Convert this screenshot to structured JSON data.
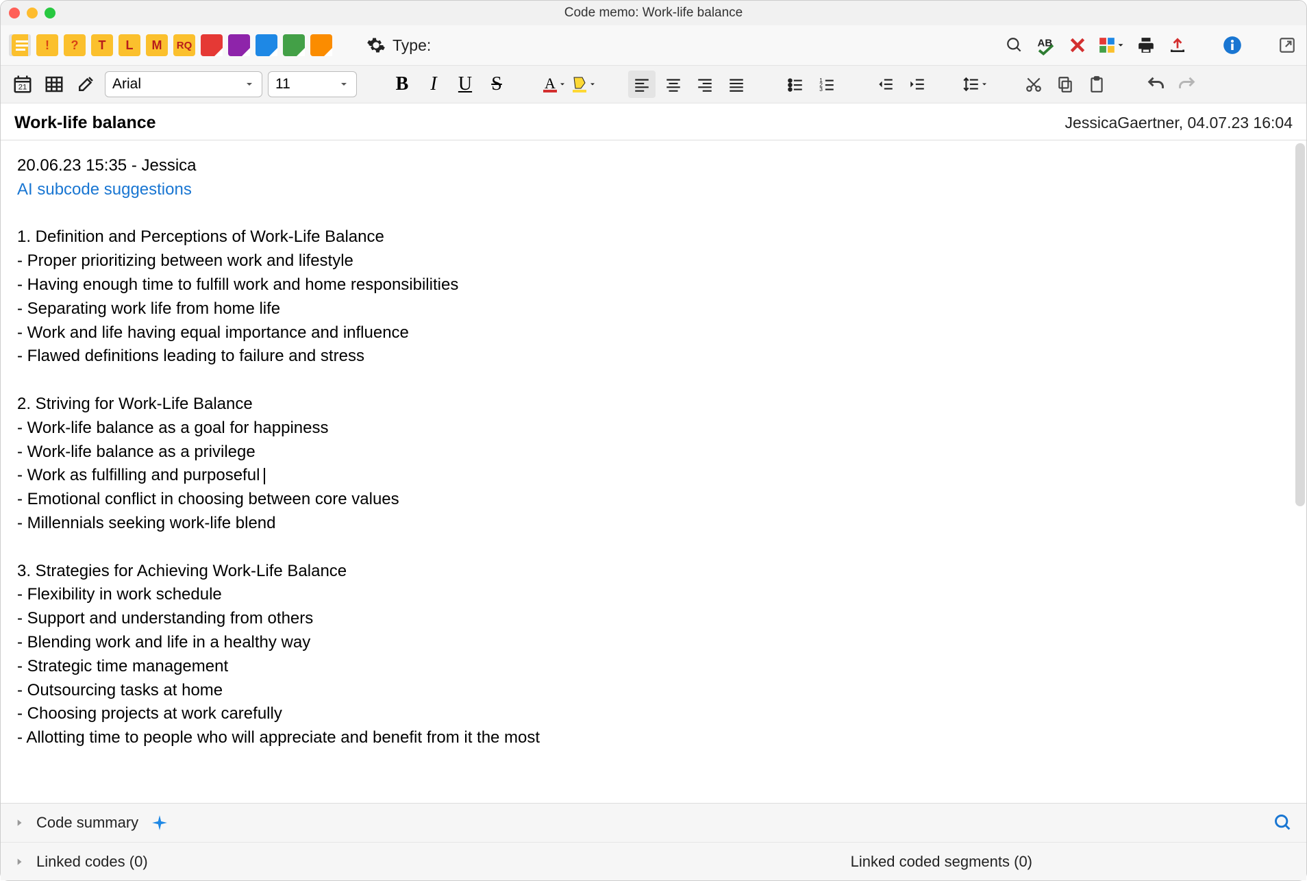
{
  "window": {
    "title": "Code memo: Work-life balance"
  },
  "toolbar1": {
    "type_label": "Type:"
  },
  "toolbar2": {
    "font": "Arial",
    "size": "11"
  },
  "header": {
    "title": "Work-life balance",
    "meta": "JessicaGaertner, 04.07.23 16:04"
  },
  "content": {
    "timestamp": "20.06.23 15:35 - Jessica",
    "ai_link": "AI subcode suggestions",
    "section1_title": "1. Definition and Perceptions of Work-Life Balance",
    "s1_b1": "- Proper prioritizing between work and lifestyle",
    "s1_b2": "- Having enough time to fulfill work and home responsibilities",
    "s1_b3": "- Separating work life from home life",
    "s1_b4": "- Work and life having equal importance and influence",
    "s1_b5": "- Flawed definitions leading to failure and stress",
    "section2_title": "2. Striving for Work-Life Balance",
    "s2_b1": "- Work-life balance as a goal for happiness",
    "s2_b2": "- Work-life balance as a privilege",
    "s2_b3": "- Work as fulfilling and purposeful",
    "s2_b4": "- Emotional conflict in choosing between core values",
    "s2_b5": "- Millennials seeking work-life blend",
    "section3_title": "3. Strategies for Achieving Work-Life Balance",
    "s3_b1": "- Flexibility in work schedule",
    "s3_b2": "- Support and understanding from others",
    "s3_b3": "- Blending work and life in a healthy way",
    "s3_b4": "- Strategic time management",
    "s3_b5": "- Outsourcing tasks at home",
    "s3_b6": "- Choosing projects at work carefully",
    "s3_b7": "- Allotting time to people who will appreciate and benefit from it the most"
  },
  "footer": {
    "summary_label": "Code summary",
    "linked_codes": "Linked codes (0)",
    "linked_segments": "Linked coded segments (0)"
  }
}
